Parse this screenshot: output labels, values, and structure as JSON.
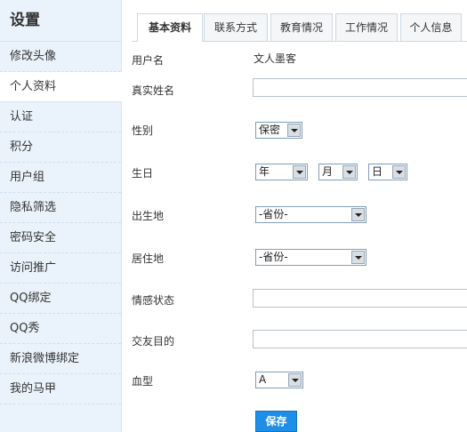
{
  "sidebar": {
    "title": "设置",
    "items": [
      {
        "label": "修改头像"
      },
      {
        "label": "个人资料"
      },
      {
        "label": "认证"
      },
      {
        "label": "积分"
      },
      {
        "label": "用户组"
      },
      {
        "label": "隐私筛选"
      },
      {
        "label": "密码安全"
      },
      {
        "label": "访问推广"
      },
      {
        "label": "QQ绑定"
      },
      {
        "label": "QQ秀"
      },
      {
        "label": "新浪微博绑定"
      },
      {
        "label": "我的马甲"
      }
    ]
  },
  "tabs": [
    {
      "label": "基本资料"
    },
    {
      "label": "联系方式"
    },
    {
      "label": "教育情况"
    },
    {
      "label": "工作情况"
    },
    {
      "label": "个人信息"
    }
  ],
  "form": {
    "username": {
      "label": "用户名",
      "value": "文人墨客"
    },
    "realname": {
      "label": "真实姓名",
      "value": ""
    },
    "gender": {
      "label": "性别",
      "value": "保密"
    },
    "birthday": {
      "label": "生日",
      "year": "年",
      "month": "月",
      "day": "日"
    },
    "birthplace": {
      "label": "出生地",
      "value": "-省份-"
    },
    "residence": {
      "label": "居住地",
      "value": "-省份-"
    },
    "relationship": {
      "label": "情感状态",
      "value": ""
    },
    "purpose": {
      "label": "交友目的",
      "value": ""
    },
    "bloodtype": {
      "label": "血型",
      "value": "A"
    },
    "save_label": "保存"
  }
}
